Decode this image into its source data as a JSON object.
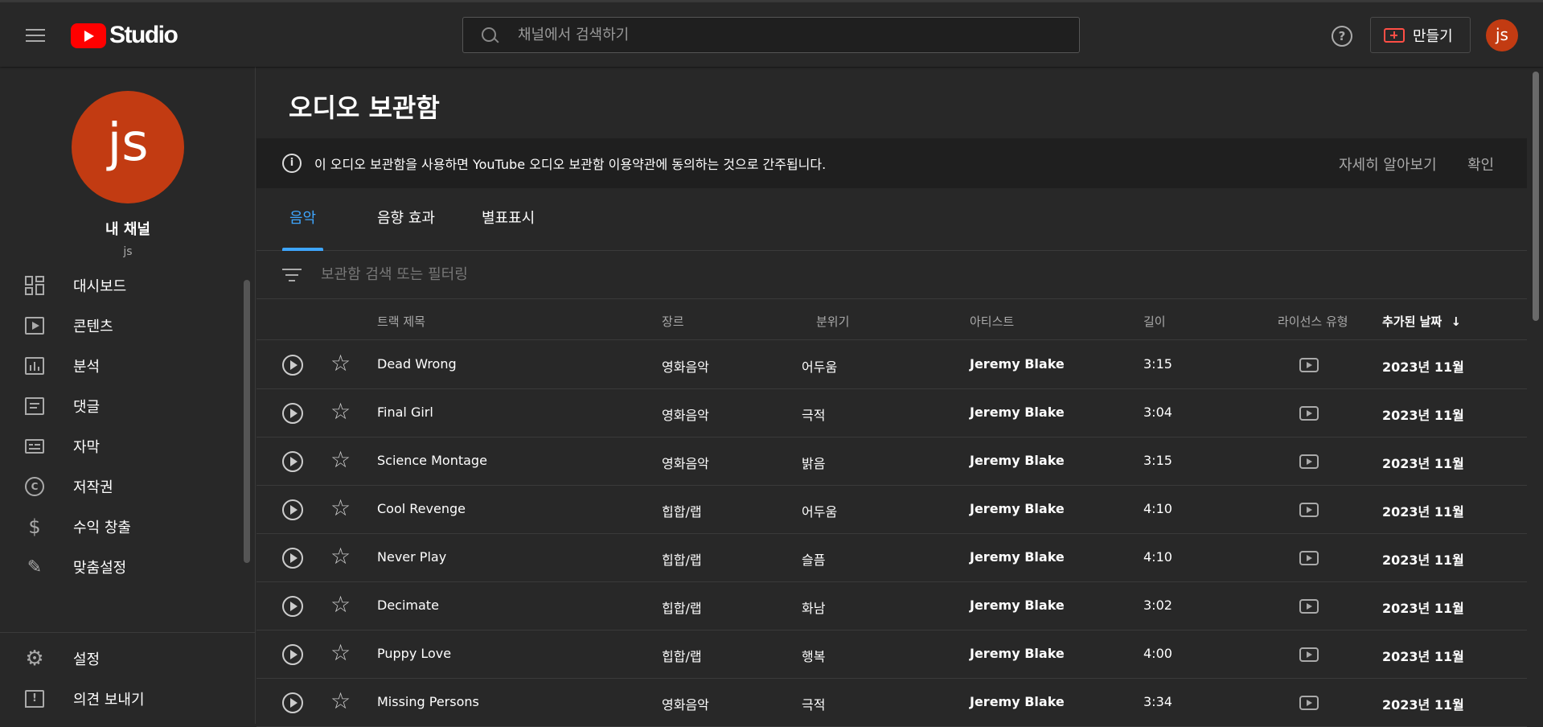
{
  "header": {
    "logo_text": "Studio",
    "search_placeholder": "채널에서 검색하기",
    "create_label": "만들기",
    "avatar_initials": "js"
  },
  "sidebar": {
    "avatar_initials": "js",
    "channel_name": "내 채널",
    "channel_handle": "js",
    "items": [
      {
        "label": "대시보드",
        "icon": "dashboard-icon"
      },
      {
        "label": "콘텐츠",
        "icon": "content-icon"
      },
      {
        "label": "분석",
        "icon": "analytics-icon"
      },
      {
        "label": "댓글",
        "icon": "comments-icon"
      },
      {
        "label": "자막",
        "icon": "subtitles-icon"
      },
      {
        "label": "저작권",
        "icon": "copyright-icon"
      },
      {
        "label": "수익 창출",
        "icon": "dollar-icon"
      },
      {
        "label": "맞춤설정",
        "icon": "customization-icon"
      }
    ],
    "bottom_items": [
      {
        "label": "설정",
        "icon": "gear-icon"
      },
      {
        "label": "의견 보내기",
        "icon": "feedback-icon"
      }
    ]
  },
  "main": {
    "title": "오디오 보관함",
    "banner": {
      "text": "이 오디오 보관함을 사용하면 YouTube 오디오 보관함 이용약관에 동의하는 것으로 간주됩니다.",
      "learn_more": "자세히 알아보기",
      "confirm": "확인"
    },
    "tabs": [
      {
        "label": "음악",
        "active": true
      },
      {
        "label": "음향 효과",
        "active": false
      },
      {
        "label": "별표표시",
        "active": false
      }
    ],
    "filter_placeholder": "보관함 검색 또는 필터링",
    "columns": {
      "title": "트랙 제목",
      "genre": "장르",
      "mood": "분위기",
      "artist": "아티스트",
      "length": "길이",
      "license": "라이선스 유형",
      "added": "추가된 날짜",
      "sort_arrow": "↓"
    },
    "tracks": [
      {
        "title": "Dead Wrong",
        "genre": "영화음악",
        "mood": "어두움",
        "artist": "Jeremy Blake",
        "length": "3:15",
        "added": "2023년 11월"
      },
      {
        "title": "Final Girl",
        "genre": "영화음악",
        "mood": "극적",
        "artist": "Jeremy Blake",
        "length": "3:04",
        "added": "2023년 11월"
      },
      {
        "title": "Science Montage",
        "genre": "영화음악",
        "mood": "밝음",
        "artist": "Jeremy Blake",
        "length": "3:15",
        "added": "2023년 11월"
      },
      {
        "title": "Cool Revenge",
        "genre": "힙합/랩",
        "mood": "어두움",
        "artist": "Jeremy Blake",
        "length": "4:10",
        "added": "2023년 11월"
      },
      {
        "title": "Never Play",
        "genre": "힙합/랩",
        "mood": "슬픔",
        "artist": "Jeremy Blake",
        "length": "4:10",
        "added": "2023년 11월"
      },
      {
        "title": "Decimate",
        "genre": "힙합/랩",
        "mood": "화남",
        "artist": "Jeremy Blake",
        "length": "3:02",
        "added": "2023년 11월"
      },
      {
        "title": "Puppy Love",
        "genre": "힙합/랩",
        "mood": "행복",
        "artist": "Jeremy Blake",
        "length": "4:00",
        "added": "2023년 11월"
      },
      {
        "title": "Missing Persons",
        "genre": "영화음악",
        "mood": "극적",
        "artist": "Jeremy Blake",
        "length": "3:34",
        "added": "2023년 11월"
      }
    ]
  },
  "colors": {
    "background": "#282828",
    "accent": "#3ea6ff",
    "brand_red": "#ff0000",
    "avatar": "#c23b12"
  }
}
